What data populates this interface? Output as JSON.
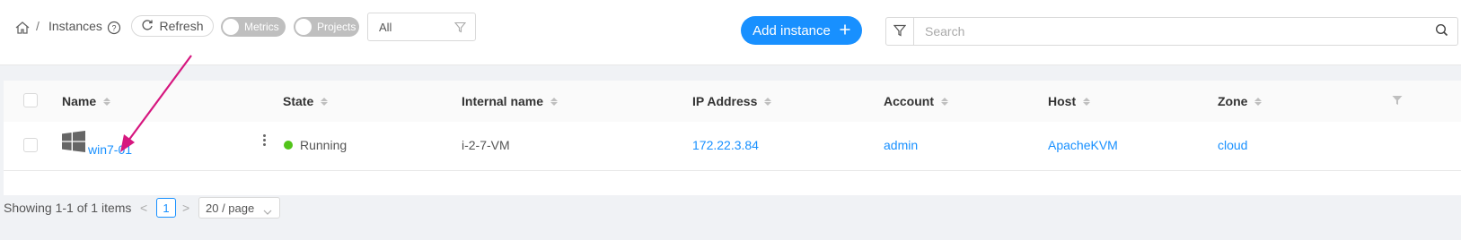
{
  "breadcrumb": {
    "home_icon": "home-icon",
    "separator": "/",
    "title": "Instances",
    "help_icon": "question-circle-icon"
  },
  "toolbar": {
    "refresh_label": "Refresh",
    "refresh_icon": "reload-icon",
    "metrics_label": "Metrics",
    "projects_label": "Projects",
    "filter_value": "All",
    "filter_icon": "funnel-icon",
    "add_label": "Add instance",
    "add_icon": "plus-icon",
    "search_placeholder": "Search",
    "search_icon": "search-icon"
  },
  "table": {
    "columns": [
      "Name",
      "State",
      "Internal name",
      "IP Address",
      "Account",
      "Host",
      "Zone"
    ],
    "rows": [
      {
        "os_icon": "windows-icon",
        "name": "win7-01",
        "state": "Running",
        "internal_name": "i-2-7-VM",
        "ip_address": "172.22.3.84",
        "account": "admin",
        "host": "ApacheKVM",
        "zone": "cloud"
      }
    ]
  },
  "pagination": {
    "summary": "Showing 1-1 of 1 items",
    "prev": "<",
    "current_page": "1",
    "next": ">",
    "page_size": "20 / page"
  },
  "colors": {
    "accent": "#1890ff",
    "running": "#52c41a",
    "annotation_arrow": "#d6177f"
  }
}
